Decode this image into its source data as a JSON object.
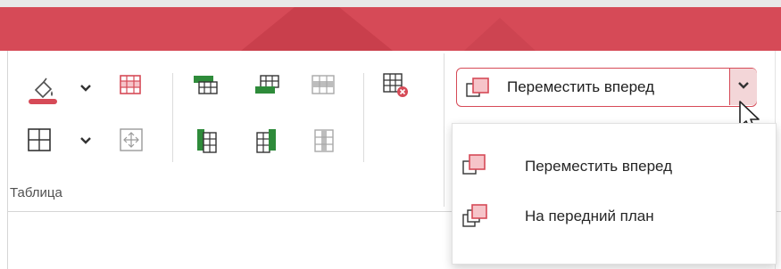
{
  "ribbon": {
    "accent_color": "#d64a57",
    "group_label": "Таблица",
    "icons": [
      "fill-color-icon",
      "chevron-down-icon",
      "table-row-highlight-icon",
      "insert-row-above-icon",
      "insert-row-below-icon",
      "delete-row-icon",
      "delete-table-icon",
      "borders-icon",
      "chevron-down-icon",
      "cell-margins-icon",
      "insert-column-left-icon",
      "insert-column-right-icon",
      "delete-column-icon"
    ]
  },
  "arrange": {
    "combo_label": "Переместить вперед",
    "combo_icon": "bring-forward-icon",
    "dropdown_icon": "chevron-down-icon"
  },
  "dropdown": {
    "items": [
      {
        "label": "Переместить вперед",
        "icon": "bring-forward-icon"
      },
      {
        "label": "На передний план",
        "icon": "bring-to-front-icon"
      }
    ]
  }
}
